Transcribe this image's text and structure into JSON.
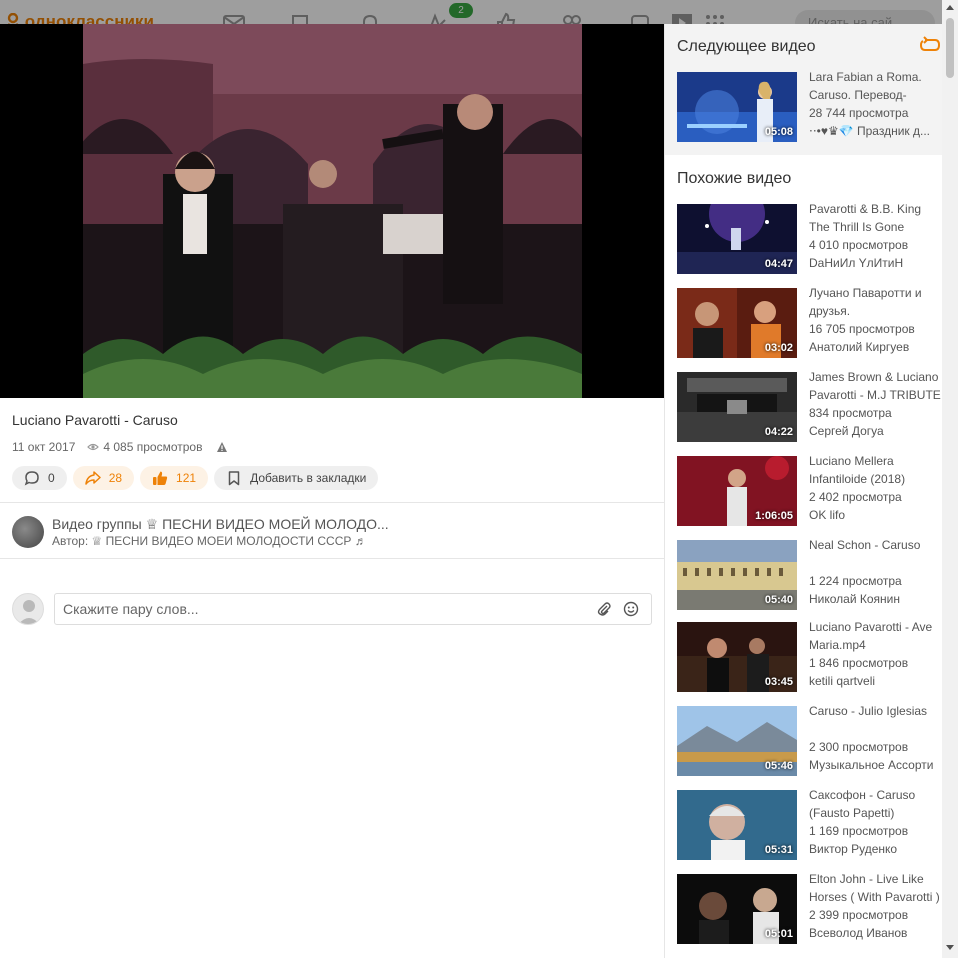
{
  "topbar": {
    "logo_text": "одноклассники",
    "notifications_count": "2",
    "search_placeholder": "Искать на сай"
  },
  "video": {
    "title": "Luciano Pavarotti - Caruso",
    "date": "11 окт 2017",
    "views": "4 085 просмотров",
    "comments_count": "0",
    "shares_count": "28",
    "likes_count": "121",
    "bookmark_label": "Добавить в закладки"
  },
  "group": {
    "line": "Видео группы ♕ ПЕСНИ ВИДЕО МОЕЙ МОЛОДО...",
    "author": "Автор: ♕ ПЕСНИ ВИДЕО МОЕИ МОЛОДОСТИ СССР ♬"
  },
  "comment": {
    "placeholder": "Скажите пару слов..."
  },
  "next": {
    "title": "Следующее видео",
    "item": {
      "name": "Lara Fabian a Roma. Caruso. Перевод-",
      "views": "28 744 просмотра",
      "author": "⋅⋅•♥♛💎 Праздник д...",
      "duration": "05:08"
    }
  },
  "similar": {
    "title": "Похожие видео",
    "items": [
      {
        "name": "Pavarotti & B.B. King The Thrill Is Gone",
        "views": "4 010 просмотров",
        "author": "DaНиИл YлИтиН",
        "duration": "04:47"
      },
      {
        "name": "Лучано Паваротти и друзья.",
        "views": "16 705 просмотров",
        "author": "Анатолий Киргуев",
        "duration": "03:02"
      },
      {
        "name": "James Brown & Luciano Pavarotti - M.J TRIBUTE",
        "views": "834 просмотра",
        "author": "Сергей Догуа",
        "duration": "04:22"
      },
      {
        "name": "Luciano Mellera Infantiloide (2018)",
        "views": "2 402 просмотра",
        "author": "OK lifo",
        "duration": "1:06:05"
      },
      {
        "name": "Neal Schon - Caruso",
        "views": "1 224 просмотра",
        "author": "Николай Коянин",
        "duration": "05:40"
      },
      {
        "name": "Luciano Pavarotti - Ave Maria.mp4",
        "views": "1 846 просмотров",
        "author": "ketili qartveli",
        "duration": "03:45"
      },
      {
        "name": "Caruso - Julio Iglesias",
        "views": "2 300 просмотров",
        "author": "Музыкальное Ассорти",
        "duration": "05:46"
      },
      {
        "name": "Саксофон - Caruso (Fausto Papetti)",
        "views": "1 169 просмотров",
        "author": "Виктор Руденко",
        "duration": "05:31"
      },
      {
        "name": "Elton John - Live Like Horses ( With Pavarotti )",
        "views": "2 399 просмотров",
        "author": "Всеволод Иванов",
        "duration": "05:01"
      }
    ]
  },
  "colors": {
    "accent": "#ee8208",
    "badge": "#39a843"
  }
}
